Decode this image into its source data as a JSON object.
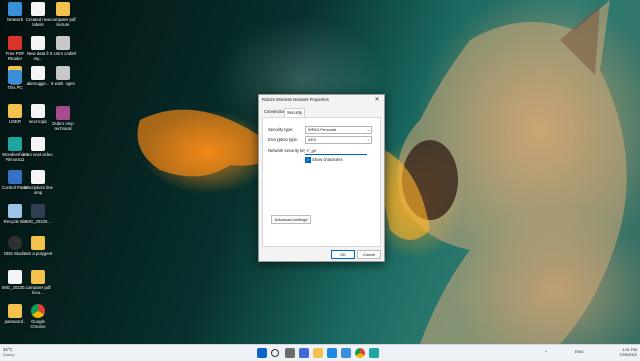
{
  "desktop_icons": [
    {
      "label": "Network"
    },
    {
      "label": "Created new labels"
    },
    {
      "label": "computer pdf lecture"
    },
    {
      "label": "Free PDF Reader"
    },
    {
      "label": "New data fr my..."
    },
    {
      "label": "5 cmrn cmbtrl"
    },
    {
      "label": "New"
    },
    {
      "label": "abenugge..."
    },
    {
      "label": "5 wish. vgen"
    },
    {
      "label": "This PC"
    },
    {
      "label": "USER"
    },
    {
      "label": "next topic"
    },
    {
      "label": "Dubro omp technical"
    },
    {
      "label": "Wondershare Filmora11"
    },
    {
      "label": "intro next video"
    },
    {
      "label": "Control Panel"
    },
    {
      "label": "descriptiom line omp"
    },
    {
      "label": "Recycle Bin"
    },
    {
      "label": "IMG_20220..."
    },
    {
      "label": "OBS Studio"
    },
    {
      "label": "ram a polygent"
    },
    {
      "label": "IMG_20220..."
    },
    {
      "label": "computer pdf lecu..."
    },
    {
      "label": "password ."
    },
    {
      "label": "Google Chrome"
    }
  ],
  "dialog": {
    "title": "Robizs Wireless Network Properties",
    "close_glyph": "✕",
    "tabs": [
      {
        "label": "Connection"
      },
      {
        "label": "Security"
      }
    ],
    "security_type_label": "Security type:",
    "security_type_value": "WPA2-Personal",
    "encryption_type_label": "Encryption type:",
    "encryption_type_value": "AES",
    "key_label": "Network security key",
    "key_value": "F_g9",
    "show_characters_label": "Show characters",
    "show_characters_checked": true,
    "advanced_settings_label": "Advanced settings",
    "ok_label": "OK",
    "cancel_label": "Cancel",
    "dropdown_glyph": "⌄",
    "check_glyph": "✓"
  },
  "taskbar": {
    "weather_temp": "34°C",
    "weather_desc": "Sunny",
    "time": "1:31 PM",
    "date": "7/29/2022",
    "language": "ENG",
    "tray_chevron": "^",
    "accent_color": "#0067c0"
  }
}
